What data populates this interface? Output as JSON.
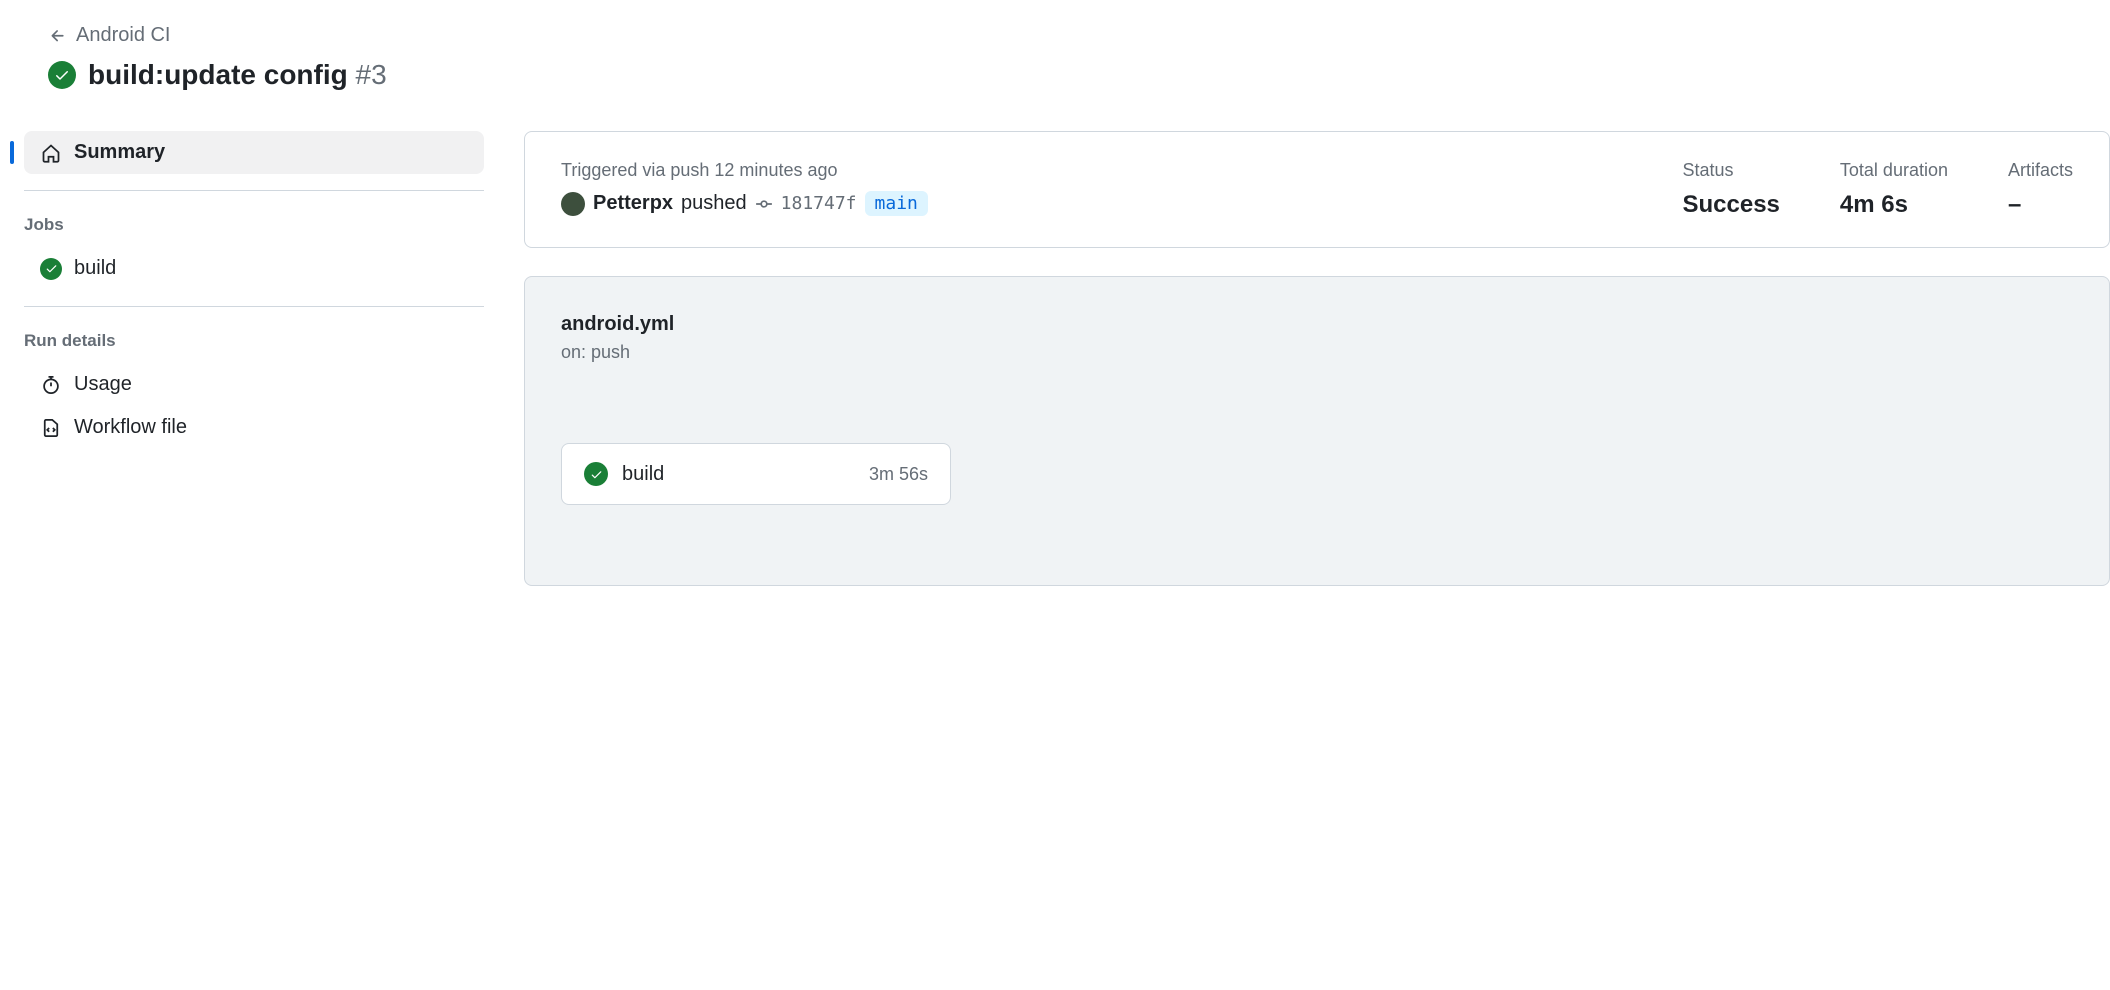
{
  "header": {
    "breadcrumb": "Android CI",
    "title": "build:update config",
    "run_number": "#3"
  },
  "sidebar": {
    "summary_label": "Summary",
    "jobs_heading": "Jobs",
    "jobs": [
      {
        "name": "build"
      }
    ],
    "details_heading": "Run details",
    "details": [
      {
        "label": "Usage",
        "icon": "stopwatch-icon"
      },
      {
        "label": "Workflow file",
        "icon": "file-code-icon"
      }
    ]
  },
  "summary": {
    "trigger_label": "Triggered via push 12 minutes ago",
    "author": "Petterpx",
    "action": "pushed",
    "commit_sha": "181747f",
    "branch": "main",
    "status_label": "Status",
    "status_value": "Success",
    "duration_label": "Total duration",
    "duration_value": "4m 6s",
    "artifacts_label": "Artifacts",
    "artifacts_value": "–"
  },
  "workflow": {
    "file": "android.yml",
    "on": "on: push",
    "jobs": [
      {
        "name": "build",
        "duration": "3m 56s"
      }
    ]
  }
}
